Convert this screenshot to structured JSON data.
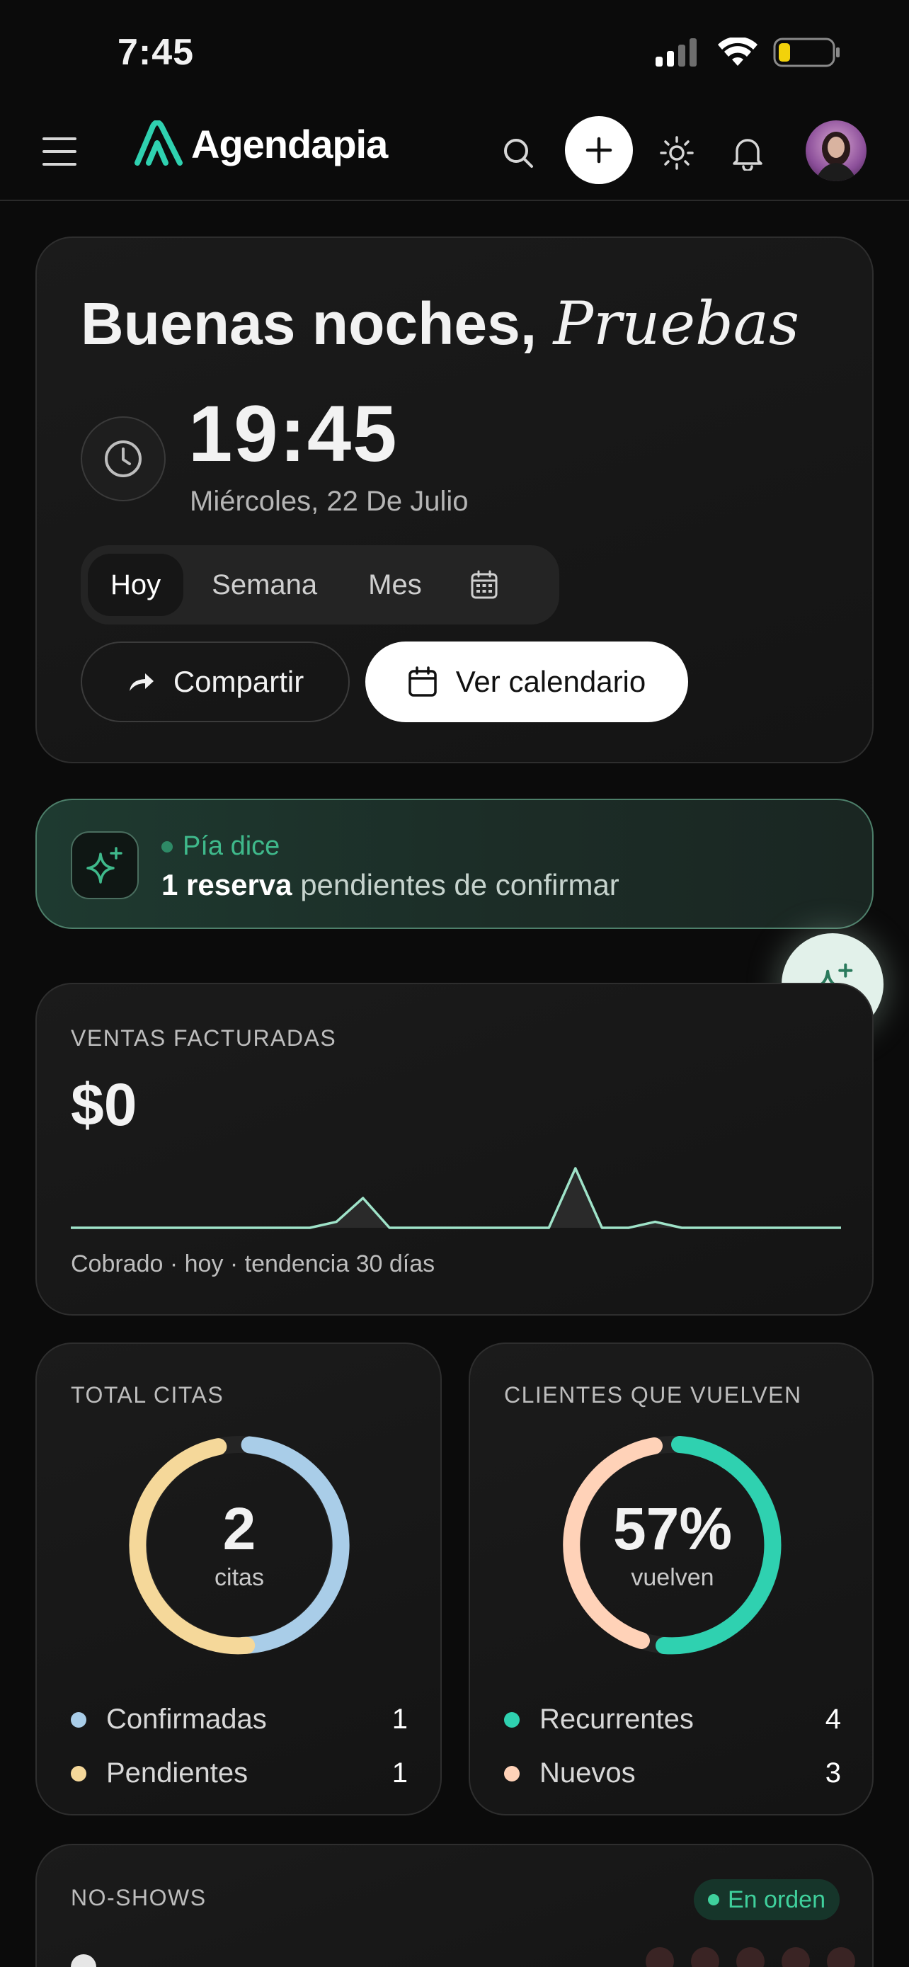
{
  "status_bar": {
    "time": "7:45"
  },
  "header": {
    "logo_text": "Agendapia",
    "icons": [
      "menu-icon",
      "search-icon",
      "plus-icon",
      "sun-icon",
      "bell-icon",
      "avatar"
    ],
    "accent": "#2fd1b0"
  },
  "greeting": {
    "prefix": "Buenas noches,",
    "name": "Pruebas",
    "time": "19:45",
    "date": "Miércoles, 22 De Julio",
    "tabs": [
      {
        "label": "Hoy",
        "active": true
      },
      {
        "label": "Semana",
        "active": false
      },
      {
        "label": "Mes",
        "active": false
      }
    ],
    "share_label": "Compartir",
    "calendar_label": "Ver calendario"
  },
  "pia": {
    "name": "Pía dice",
    "count": "1 reserva",
    "message": "pendientes de confirmar",
    "accent": "#3fb98b"
  },
  "sales": {
    "title": "VENTAS FACTURADAS",
    "value": "$0",
    "footer": "Cobrado · hoy · tendencia 30 días",
    "line_color": "#9fe3c9",
    "trend": [
      0,
      0,
      0,
      0,
      0,
      0,
      0,
      0,
      0,
      0,
      0.1,
      0.5,
      0,
      0,
      0,
      0,
      0,
      0,
      0,
      1,
      0,
      0,
      0.1,
      0,
      0,
      0,
      0,
      0,
      0,
      0
    ]
  },
  "citas": {
    "title": "TOTAL CITAS",
    "total": "2",
    "sub": "citas",
    "legend": [
      {
        "label": "Confirmadas",
        "value": "1",
        "color": "#a9cde8"
      },
      {
        "label": "Pendientes",
        "value": "1",
        "color": "#f5d89a"
      }
    ]
  },
  "returning": {
    "title": "CLIENTES QUE VUELVEN",
    "percent": "57%",
    "sub": "vuelven",
    "legend": [
      {
        "label": "Recurrentes",
        "value": "4",
        "color": "#2fd1b0"
      },
      {
        "label": "Nuevos",
        "value": "3",
        "color": "#ffd2b8"
      }
    ]
  },
  "noshows": {
    "title": "NO-SHOWS",
    "badge": "En orden"
  }
}
